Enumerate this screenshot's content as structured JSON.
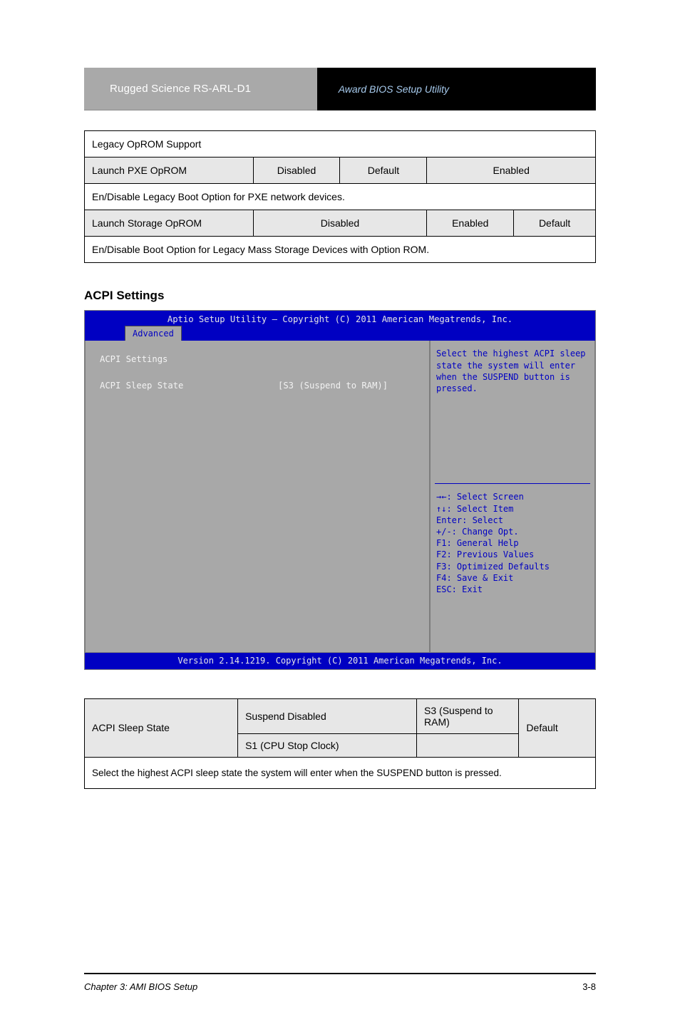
{
  "banner": {
    "left": "Rugged Science  RS-ARL-D1",
    "right_prefix": "Award BIOS Setup Utility",
    "right_suffix": ""
  },
  "table1": {
    "row1": {
      "c1": "Legacy OpROM Support"
    },
    "row2": {
      "c1": "Launch PXE OpROM",
      "c2_a": "Disabled",
      "c2_b": "Default",
      "c3": "Enabled"
    },
    "row3": {
      "desc": "En/Disable Legacy Boot Option for PXE network devices."
    },
    "row4": {
      "c1": "Launch Storage OpROM",
      "c2_a": "Disabled",
      "c3_a": "Enabled",
      "c3_b": "Default"
    },
    "row5": {
      "desc": "En/Disable Boot Option for Legacy Mass Storage Devices with Option ROM."
    }
  },
  "section_heading": "ACPI Settings",
  "bios": {
    "title": "Aptio Setup Utility – Copyright (C) 2011 American Megatrends, Inc.",
    "tab": "Advanced",
    "main_heading": "ACPI Settings",
    "item_label": "ACPI Sleep State",
    "item_value": "[S3 (Suspend to RAM)]",
    "help_text": "Select the highest ACPI sleep state the system will enter when the SUSPEND button is pressed.",
    "keys": [
      "→←: Select Screen",
      "↑↓: Select Item",
      "Enter: Select",
      "+/-: Change Opt.",
      "F1: General Help",
      "F2: Previous Values",
      "F3: Optimized Defaults",
      "F4: Save & Exit",
      "ESC: Exit"
    ],
    "footer": "Version 2.14.1219. Copyright (C) 2011 American Megatrends, Inc."
  },
  "acpi_table": {
    "label": "ACPI Sleep State",
    "opt1": "Suspend Disabled",
    "opt2": "S1 (CPU Stop Clock)",
    "opt3_a": "S3 (Suspend to RAM)",
    "opt3_b": "Default",
    "desc": "Select the highest ACPI sleep state the system will enter when the SUSPEND button is pressed."
  },
  "footer": {
    "left": "Chapter 3: AMI BIOS Setup",
    "right": "3-8"
  }
}
